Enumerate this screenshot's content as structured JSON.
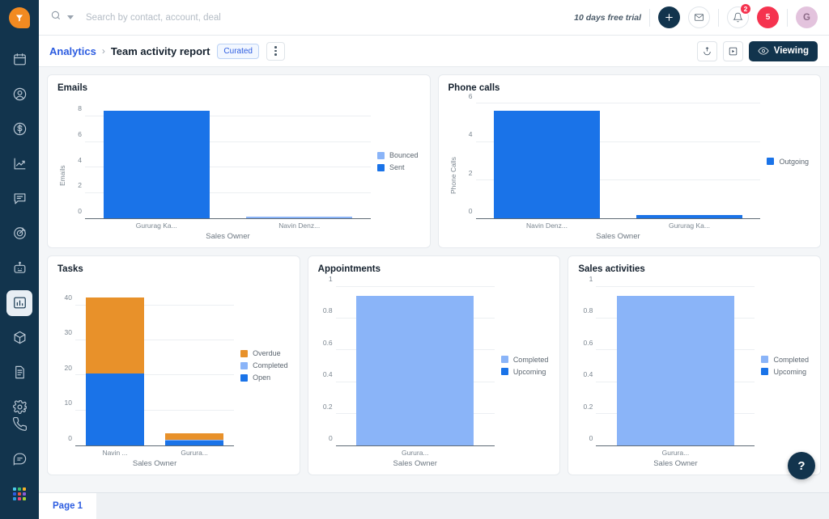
{
  "app": {
    "logo_name": "freshworks-logo",
    "accent_orange": "#f28a21",
    "sidebar_bg": "#12344d"
  },
  "sidebar": {
    "items": [
      {
        "id": "calendar",
        "icon": "calendar-icon",
        "has_submenu": false,
        "active": false
      },
      {
        "id": "contacts",
        "icon": "contacts-icon",
        "has_submenu": true,
        "active": false
      },
      {
        "id": "deals",
        "icon": "deals-icon",
        "has_submenu": true,
        "active": false
      },
      {
        "id": "forecast",
        "icon": "trending-up-icon",
        "has_submenu": false,
        "active": false
      },
      {
        "id": "chat",
        "icon": "message-icon",
        "has_submenu": true,
        "active": false
      },
      {
        "id": "campaigns",
        "icon": "target-icon",
        "has_submenu": false,
        "active": false
      },
      {
        "id": "bot",
        "icon": "bot-icon",
        "has_submenu": false,
        "active": false
      },
      {
        "id": "analytics",
        "icon": "bar-chart-icon",
        "has_submenu": false,
        "active": true
      },
      {
        "id": "products",
        "icon": "cube-icon",
        "has_submenu": false,
        "active": false
      },
      {
        "id": "documents",
        "icon": "document-icon",
        "has_submenu": false,
        "active": false
      },
      {
        "id": "settings",
        "icon": "gear-icon",
        "has_submenu": false,
        "active": false
      }
    ],
    "bottom_items": [
      {
        "id": "phone",
        "icon": "phone-icon"
      },
      {
        "id": "chat-support",
        "icon": "chat-bubble-icon"
      },
      {
        "id": "apps",
        "icon": "app-grid-icon"
      }
    ],
    "app_grid_colors": [
      "#4bc8e8",
      "#3ebd6c",
      "#f5b429",
      "#2c5ce0",
      "#e8553f",
      "#8a5cd6",
      "#2c9be0",
      "#e8447f",
      "#a3d236"
    ]
  },
  "topbar": {
    "search": {
      "placeholder": "Search by contact, account, deal",
      "value": "",
      "icon": "search-icon",
      "dropdown_icon": "caret-down-icon"
    },
    "trial_text": "10 days free trial",
    "add_button": {
      "label": "+",
      "icon": "plus-icon"
    },
    "mail_button": {
      "icon": "envelope-icon"
    },
    "notification_button": {
      "icon": "bell-icon",
      "badge": "2"
    },
    "count_badge": "5",
    "avatar_initial": "G"
  },
  "breadcrumb": {
    "parent": "Analytics",
    "separator": "›",
    "title": "Team activity report",
    "chip": "Curated",
    "kebab_icon": "more-vertical-icon"
  },
  "page_actions": {
    "export_icon": "export-icon",
    "present_icon": "present-icon",
    "view_button": {
      "label": "Viewing",
      "icon": "eye-icon"
    }
  },
  "help_button": {
    "label": "?",
    "icon": "help-icon"
  },
  "page_tabs": [
    {
      "label": "Page 1",
      "active": true
    }
  ],
  "colors": {
    "dark_blue": "#1a73e8",
    "light_blue": "#8ab4f8",
    "orange": "#e8912a",
    "axis": "#5f6b76",
    "grid": "#eceff2",
    "tick_text": "#7a858f"
  },
  "chart_data": [
    {
      "id": "emails",
      "type": "bar",
      "title": "Emails",
      "stacked": true,
      "xlabel": "Sales Owner",
      "ylabel": "Emails",
      "categories": [
        "Gururag Ka...",
        "Navin Denz..."
      ],
      "yticks": [
        "0",
        "2",
        "4",
        "6",
        "8"
      ],
      "ylim": [
        0,
        9.6
      ],
      "grid": true,
      "legend_position": "right",
      "series": [
        {
          "name": "Bounced",
          "color": "#8ab4f8",
          "values": [
            0,
            1
          ]
        },
        {
          "name": "Sent",
          "color": "#1a73e8",
          "values": [
            9,
            0
          ]
        }
      ]
    },
    {
      "id": "phone-calls",
      "type": "bar",
      "title": "Phone calls",
      "stacked": true,
      "xlabel": "Sales Owner",
      "ylabel": "Phone Calls",
      "categories": [
        "Navin Denz...",
        "Gururag Ka..."
      ],
      "yticks": [
        "0",
        "2",
        "4",
        "6"
      ],
      "ylim": [
        0,
        6.4
      ],
      "grid": true,
      "legend_position": "right",
      "series": [
        {
          "name": "Outgoing",
          "color": "#1a73e8",
          "values": [
            6,
            1
          ]
        }
      ]
    },
    {
      "id": "tasks",
      "type": "bar",
      "title": "Tasks",
      "stacked": true,
      "xlabel": "Sales Owner",
      "ylabel": "",
      "categories": [
        "Navin ...",
        "Gurura..."
      ],
      "yticks": [
        "0",
        "10",
        "20",
        "30",
        "40"
      ],
      "ylim": [
        0,
        48
      ],
      "grid": true,
      "legend_position": "right",
      "series": [
        {
          "name": "Open",
          "color": "#1a73e8",
          "values": [
            22,
            5
          ]
        },
        {
          "name": "Completed",
          "color": "#8ab4f8",
          "values": [
            0,
            1
          ]
        },
        {
          "name": "Overdue",
          "color": "#e8912a",
          "values": [
            23,
            7
          ]
        }
      ],
      "legend_order": [
        "Overdue",
        "Completed",
        "Open"
      ]
    },
    {
      "id": "appointments",
      "type": "bar",
      "title": "Appointments",
      "stacked": true,
      "xlabel": "Sales Owner",
      "ylabel": "",
      "categories": [
        "Gurura..."
      ],
      "yticks": [
        "0",
        "0.2",
        "0.4",
        "0.6",
        "0.8",
        "1"
      ],
      "ylim": [
        0,
        1.06
      ],
      "grid": true,
      "legend_position": "right",
      "series": [
        {
          "name": "Completed",
          "color": "#8ab4f8",
          "values": [
            1
          ]
        },
        {
          "name": "Upcoming",
          "color": "#1a73e8",
          "values": [
            0
          ]
        }
      ]
    },
    {
      "id": "sales-activities",
      "type": "bar",
      "title": "Sales activities",
      "stacked": true,
      "xlabel": "Sales Owner",
      "ylabel": "",
      "categories": [
        "Gurura..."
      ],
      "yticks": [
        "0",
        "0.2",
        "0.4",
        "0.6",
        "0.8",
        "1"
      ],
      "ylim": [
        0,
        1.06
      ],
      "grid": true,
      "legend_position": "right",
      "series": [
        {
          "name": "Completed",
          "color": "#8ab4f8",
          "values": [
            1
          ]
        },
        {
          "name": "Upcoming",
          "color": "#1a73e8",
          "values": [
            0
          ]
        }
      ]
    }
  ]
}
